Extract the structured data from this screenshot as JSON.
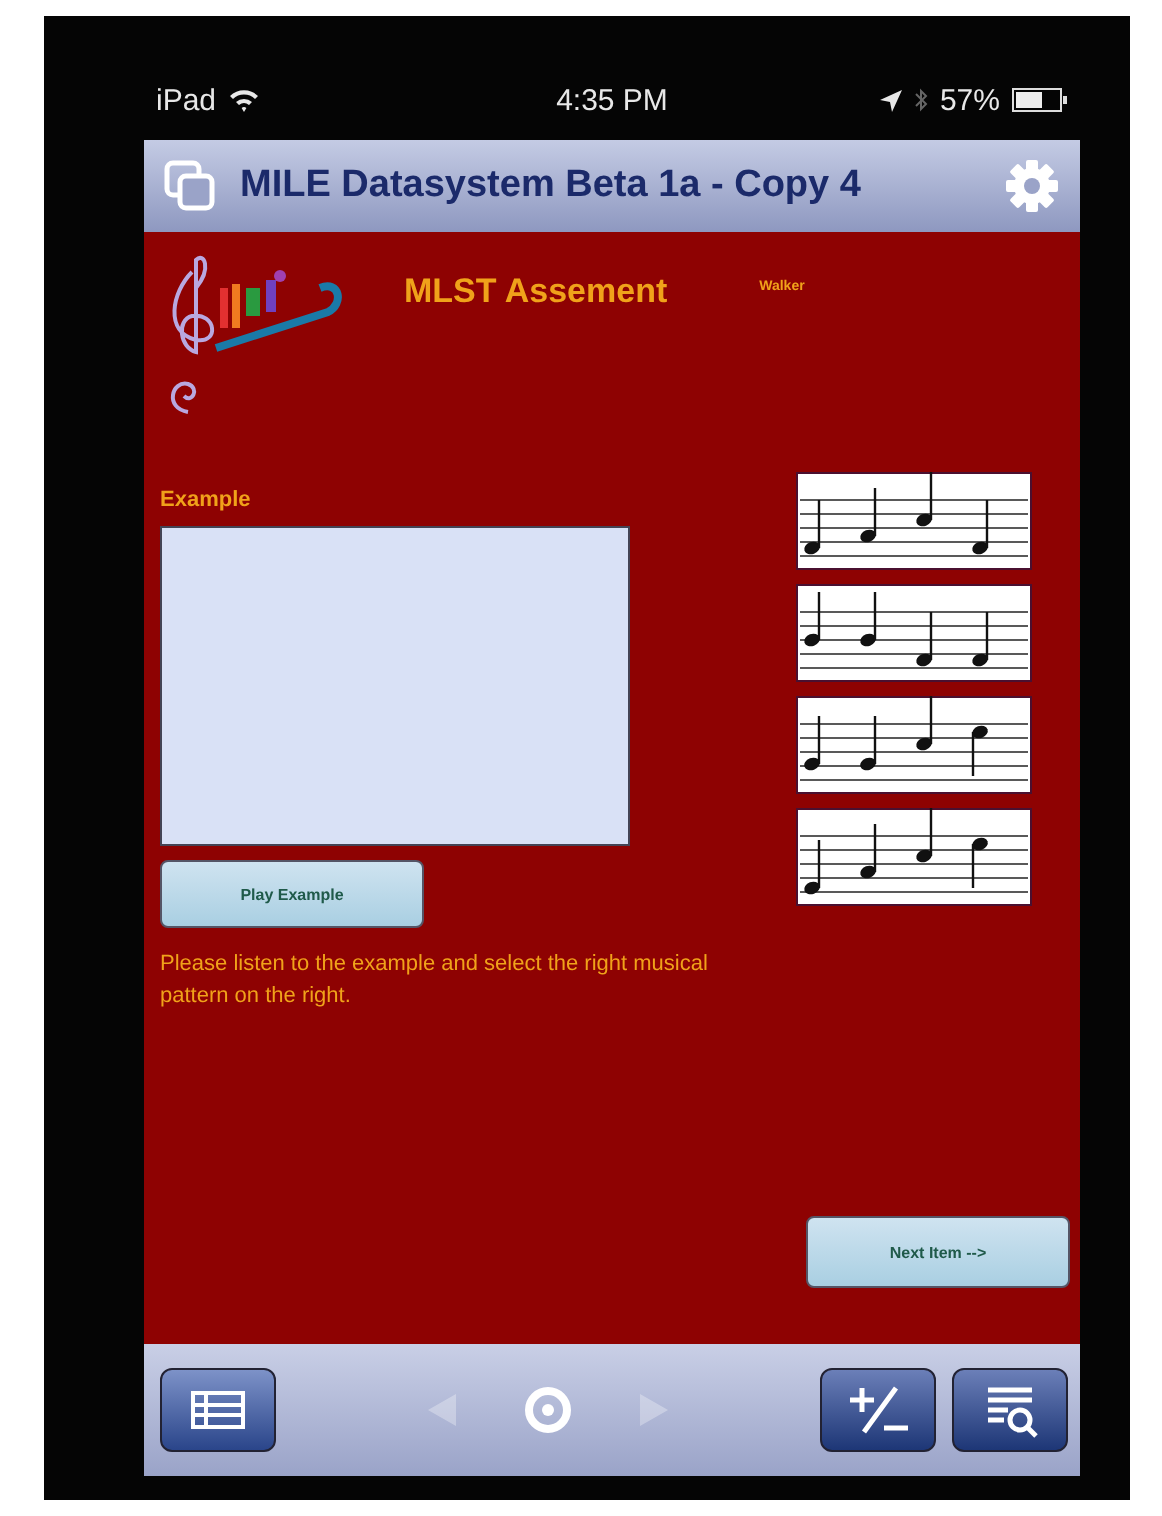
{
  "status_bar": {
    "device": "iPad",
    "time": "4:35 PM",
    "battery": "57%"
  },
  "title_bar": {
    "title": "MILE Datasystem Beta 1a - Copy 4"
  },
  "header": {
    "title": "MLST Assement",
    "student": "Walker"
  },
  "example": {
    "label": "Example",
    "play_button": "Play Example"
  },
  "instruction": "Please listen to the example and select the right musical pattern on the right.",
  "next_button": "Next Item -->",
  "toolbar": {
    "prev_disabled": true,
    "next_disabled": true
  }
}
